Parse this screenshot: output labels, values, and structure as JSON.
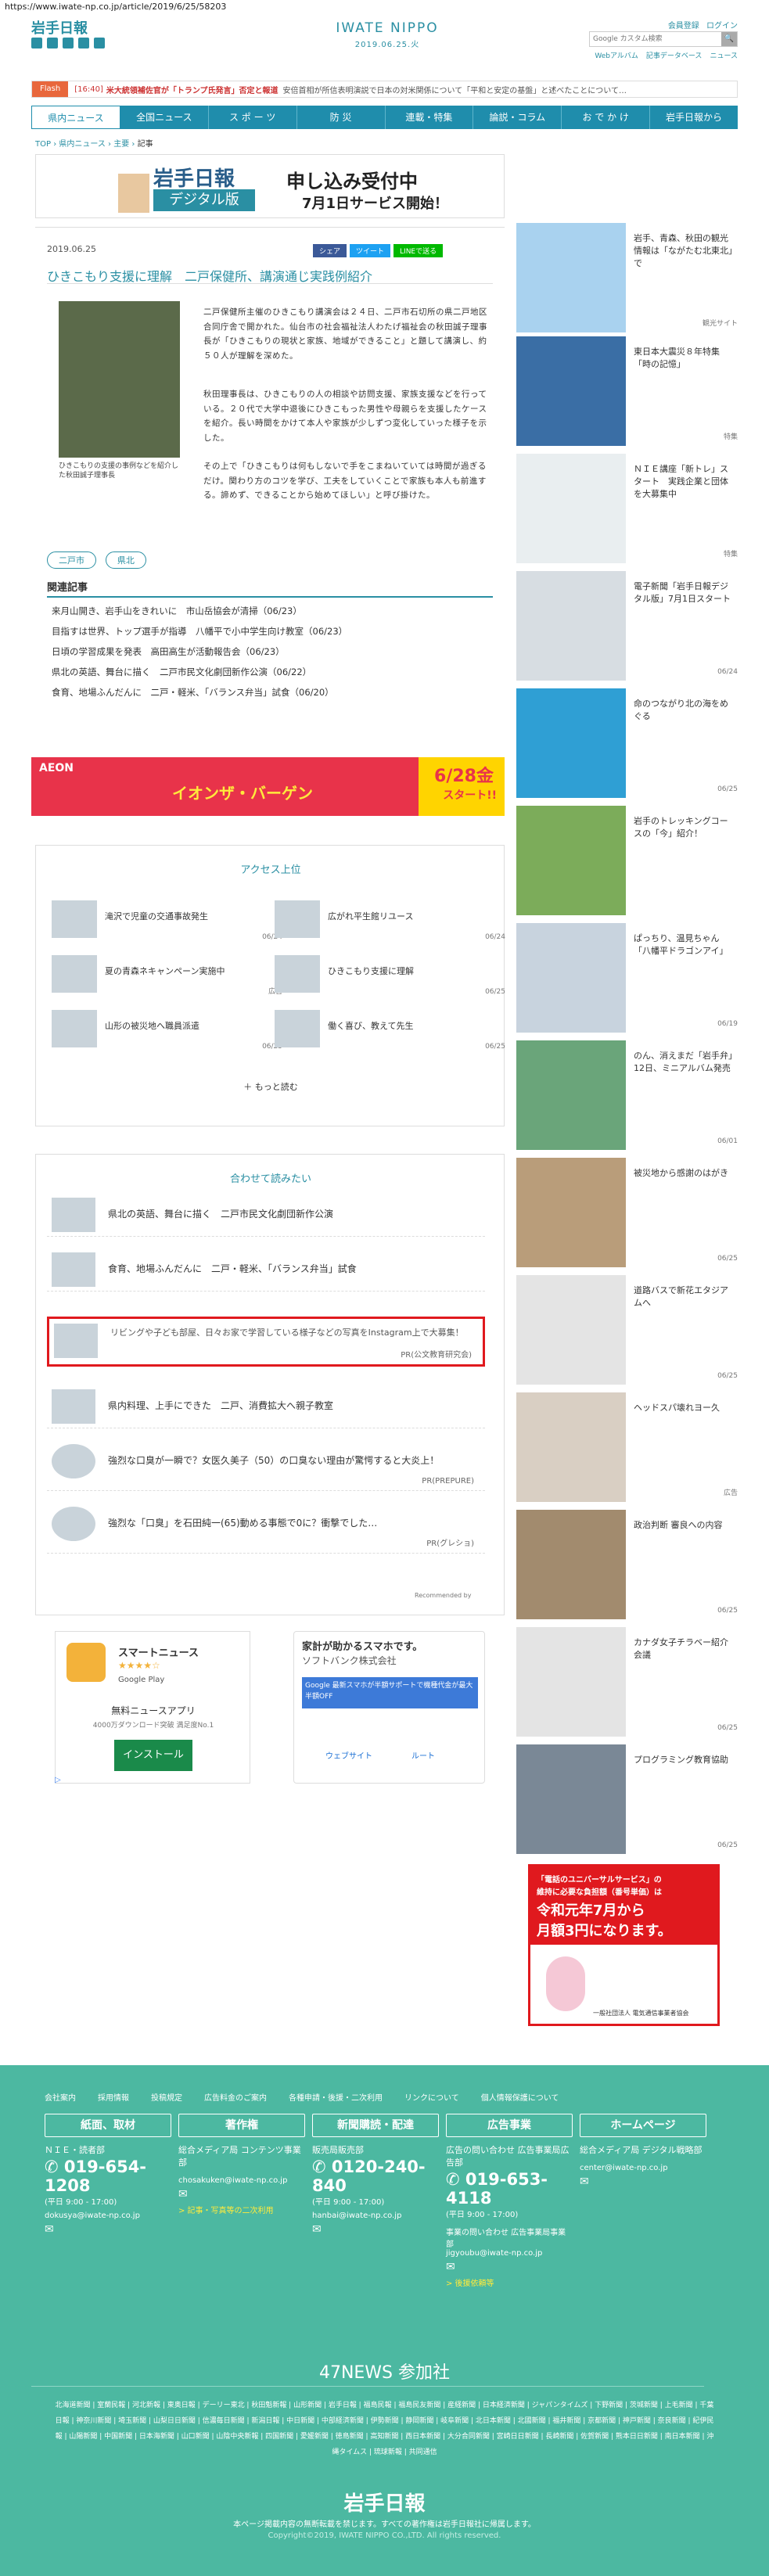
{
  "url": "https://www.iwate-np.co.jp/article/2019/6/25/58203",
  "header": {
    "logo_jp": "岩手日報",
    "logo_en": "IWATE NIPPO",
    "date": "2019.06.25.火",
    "member": "会員登録",
    "login": "ログイン",
    "links": [
      "Webアルバム",
      "記事データベース",
      "ニュース"
    ],
    "search_placeholder": "Google カスタム検索",
    "search_btn": "🔍"
  },
  "flash": {
    "label": "Flash",
    "time": "[16:40]",
    "text": "米大統領補佐官が「トランプ氏発言」否定と報道",
    "text2": "安倍首相が所信表明演説で日本の対米関係について「平和と安定の基盤」と述べたことについて…"
  },
  "nav": [
    "県内ニュース",
    "全国ニュース",
    "ス ポ ー ツ",
    "防 災",
    "連載・特集",
    "論説・コラム",
    "お で か け",
    "岩手日報から"
  ],
  "breadcrumb": [
    "TOP",
    "県内ニュース",
    "主要",
    "記事"
  ],
  "banner": {
    "logo": "岩手日報",
    "sub": "デジタル版",
    "line1": "申し込み受付中",
    "line2": "7月1日サービス開始！"
  },
  "article": {
    "date": "2019.06.25",
    "share": "シェア",
    "tweet": "ツイート",
    "line": "LINEで送る",
    "title": "ひきこもり支援に理解　二戸保健所、講演通じ実践例紹介",
    "caption": "ひきこもりの支援の事例などを紹介した秋田誠子理事長",
    "body1": "二戸保健所主催のひきこもり講演会は２４日、二戸市石切所の県二戸地区合同庁舎で開かれた。仙台市の社会福祉法人わたげ福祉会の秋田誠子理事長が「ひきこもりの現状と家族、地域ができること」と題して講演し、約５０人が理解を深めた。",
    "body2": "秋田理事長は、ひきこもりの人の相談や訪問支援、家族支援などを行っている。２０代で大学中退後にひきこもった男性や母親らを支援したケースを紹介。長い時間をかけて本人や家族が少しずつ変化していった様子を示した。",
    "body3": "その上で「ひきこもりは何もしないで手をこまねいていては時間が過ぎるだけ。関わり方のコツを学び、工夫をしていくことで家族も本人も前進する。諦めず、できることから始めてほしい」と呼び掛けた。",
    "tags": [
      "二戸市",
      "県北"
    ]
  },
  "related": {
    "title": "関連記事",
    "items": [
      "来月山開き、岩手山をきれいに　市山岳協会が清掃（06/23）",
      "目指すは世界、トップ選手が指導　八幡平で小中学生向け教室（06/23）",
      "日頃の学習成果を発表　高田高生が活動報告会（06/23）",
      "県北の英語、舞台に描く　二戸市民文化劇団新作公演（06/22）",
      "食育、地場ふんだんに　二戸・軽米、「バランス弁当」試食（06/20）"
    ]
  },
  "ad": {
    "brand": "AEON",
    "text": "イオンザ・バーゲン",
    "date": "6/28金",
    "start": "スタート!!"
  },
  "access": {
    "title": "アクセス上位",
    "items": [
      {
        "t": "滝沢で児童の交通事故発生",
        "d": "06/24"
      },
      {
        "t": "広がれ平生館リユース",
        "d": "06/24"
      },
      {
        "t": "夏の青森ネキャンペーン実施中",
        "d": "広告"
      },
      {
        "t": "ひきこもり支援に理解",
        "d": "06/25"
      },
      {
        "t": "山形の被災地へ職員派遣",
        "d": "06/25"
      },
      {
        "t": "働く喜び、教えて先生",
        "d": "06/25"
      }
    ],
    "more": "もっと読む"
  },
  "recommend": {
    "title": "合わせて読みたい",
    "items": [
      {
        "t": "県北の英語、舞台に描く　二戸市民文化劇団新作公演",
        "s": ""
      },
      {
        "t": "食育、地場ふんだんに　二戸・軽米、「バランス弁当」試食",
        "s": ""
      },
      {
        "t": "リビングや子ども部屋、日々お家で学習している様子などの写真をInstagram上で大募集！",
        "s": "PR(公文教育研究会)"
      },
      {
        "t": "県内料理、上手にできた　二戸、消費拡大へ親子教室",
        "s": ""
      },
      {
        "t": "強烈な口臭が一瞬で？女医久美子（50）の口臭ない理由が驚愕すると大炎上！",
        "s": "PR(PREPURE)"
      },
      {
        "t": "強烈な「口臭」を石田純一(65)動める事態で0に？衝撃でした…",
        "s": "PR(グレショ)"
      }
    ],
    "by": "Recommended by"
  },
  "apps": {
    "name": "スマートニュース",
    "store": "Google Play",
    "free": "無料ニュースアプリ",
    "dl": "4000万ダウンロード突破 満足度No.1",
    "install": "インストール"
  },
  "softbank": {
    "h": "家計が助かるスマホです。",
    "s": "ソフトバンク株式会社",
    "msg": "Google 最新スマホが半額サポートで機種代金が最大半額OFF",
    "web": "ウェブサイト",
    "route": "ルート"
  },
  "right": [
    {
      "t": "岩手、青森、秋田の観光情報は「ながたむ北東北」で",
      "d": "観光サイト"
    },
    {
      "t": "東日本大震災８年特集「時の記憶」",
      "d": "特集"
    },
    {
      "t": "ＮＩＥ講座「新トレ」スタート　実践企業と団体を大募集中",
      "d": "特集"
    },
    {
      "t": "電子新聞「岩手日報デジタル版」7月1日スタート",
      "d": "06/24"
    },
    {
      "t": "命のつながり北の海をめぐる",
      "d": "06/25"
    },
    {
      "t": "岩手のトレッキングコースの「今」紹介！",
      "d": ""
    },
    {
      "t": "ぱっちり、温見ちゃん「八幡平ドラゴンアイ」",
      "d": "06/19"
    },
    {
      "t": "のん、消えまだ「岩手弁」　12日、ミニアルバム発売",
      "d": "06/01"
    },
    {
      "t": "被災地から感謝のはがき",
      "d": "06/25"
    },
    {
      "t": "道路バスで新花エタジアムへ",
      "d": "06/25"
    },
    {
      "t": "ヘッドスパ壊れヨー久",
      "d": "広告"
    },
    {
      "t": "政治判断 審良への内容",
      "d": "06/25"
    },
    {
      "t": "カナダ女子チラベー紹介会議",
      "d": "06/25"
    },
    {
      "t": "プログラミング教育協助",
      "d": "06/25"
    }
  ],
  "rightad": {
    "l1": "「電話のユニバーサルサービス」の",
    "l2": "維持に必要な負担額（番号単価）は",
    "l3": "令和元年7月から",
    "l4": "月額3円になります。",
    "org": "一般社団法人 電気通信事業者協会"
  },
  "footer": {
    "links": [
      "会社案内",
      "採用情報",
      "投稿規定",
      "広告料金のご案内",
      "各種申請・後援・二次利用",
      "リンクについて",
      "個人情報保護について"
    ],
    "cols": [
      {
        "h": "紙面、取材",
        "sub": "ＮＩＥ・読者部",
        "num": "019-654-1208",
        "time": "(平日 9:00 - 17:00)",
        "mail": "dokusya@iwate-np.co.jp"
      },
      {
        "h": "著作権",
        "sub": "総合メディア局 コンテンツ事業部",
        "num": "",
        "time": "",
        "mail": "chosakuken@iwate-np.co.jp",
        "link": "> 記事・写真等の二次利用"
      },
      {
        "h": "新聞購読・配達",
        "sub": "販売局販売部",
        "num": "0120-240-840",
        "time": "(平日 9:00 - 17:00)",
        "mail": "hanbai@iwate-np.co.jp"
      },
      {
        "h": "広告事業",
        "sub": "広告の問い合わせ 広告事業局広告部",
        "num": "019-653-4118",
        "time": "(平日 9:00 - 17:00)",
        "mail": "",
        "sub2": "事業の問い合わせ 広告事業局事業部",
        "mail2": "jigyoubu@iwate-np.co.jp",
        "link": "> 後援依頼等"
      },
      {
        "h": "ホームページ",
        "sub": "総合メディア局 デジタル戦略部",
        "num": "",
        "time": "",
        "mail": "center@iwate-np.co.jp"
      }
    ],
    "n47": "47NEWS 参加社",
    "papers": "北海道新聞 | 室蘭民報 | 河北新報 | 東奥日報 | デーリー東北 | 秋田魁新報 | 山形新聞 | 岩手日報 | 福島民報 | 福島民友新聞 | 産経新聞 | 日本経済新聞 | ジャパンタイムズ | 下野新聞 | 茨城新聞 | 上毛新聞 | 千葉日報 | 神奈川新聞 | 埼玉新聞 | 山梨日日新聞 | 信濃毎日新聞 | 新潟日報 | 中日新聞 | 中部経済新聞 | 伊勢新聞 | 静岡新聞 | 岐阜新聞 | 北日本新聞 | 北國新聞 | 福井新聞 | 京都新聞 | 神戸新聞 | 奈良新聞 | 紀伊民報 | 山陽新聞 | 中国新聞 | 日本海新聞 | 山口新聞 | 山陰中央新報 | 四国新聞 | 愛媛新聞 | 徳島新聞 | 高知新聞 | 西日本新聞 | 大分合同新聞 | 宮崎日日新聞 | 長崎新聞 | 佐賀新聞 | 熊本日日新聞 | 南日本新聞 | 沖縄タイムス | 琉球新報 | 共同通信",
    "logo": "岩手日報",
    "notice": "本ページ掲載内容の無断転載を禁じます。すべての著作権は岩手日報社に帰属します。",
    "copy": "Copyright©2019, IWATE NIPPO CO.,LTD. All rights reserved."
  }
}
